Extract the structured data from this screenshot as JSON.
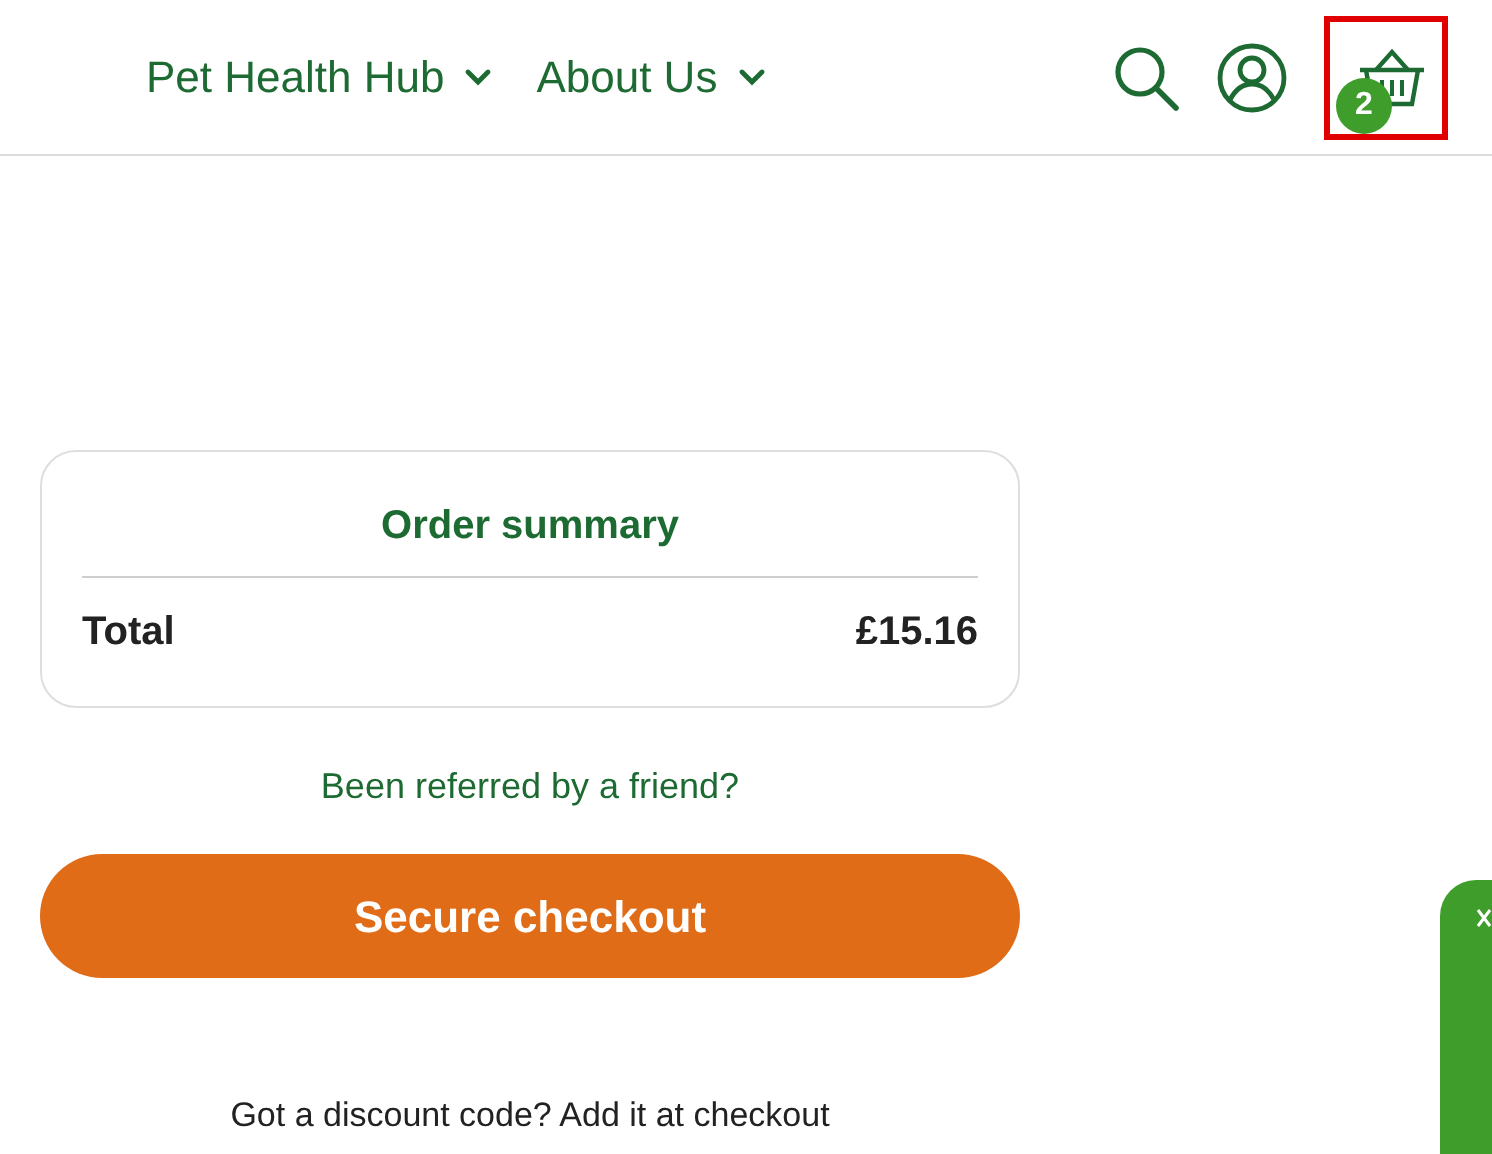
{
  "nav": [
    {
      "label": "Pet Health Hub",
      "expanded": false
    },
    {
      "label": "About Us",
      "expanded": false
    }
  ],
  "cart": {
    "count": "2",
    "highlighted": true
  },
  "summary": {
    "title": "Order summary",
    "total_label": "Total",
    "total_value": "£15.16"
  },
  "referral_link": "Been referred by a friend?",
  "checkout_button": "Secure checkout",
  "discount_note": "Got a discount code? Add it at checkout"
}
